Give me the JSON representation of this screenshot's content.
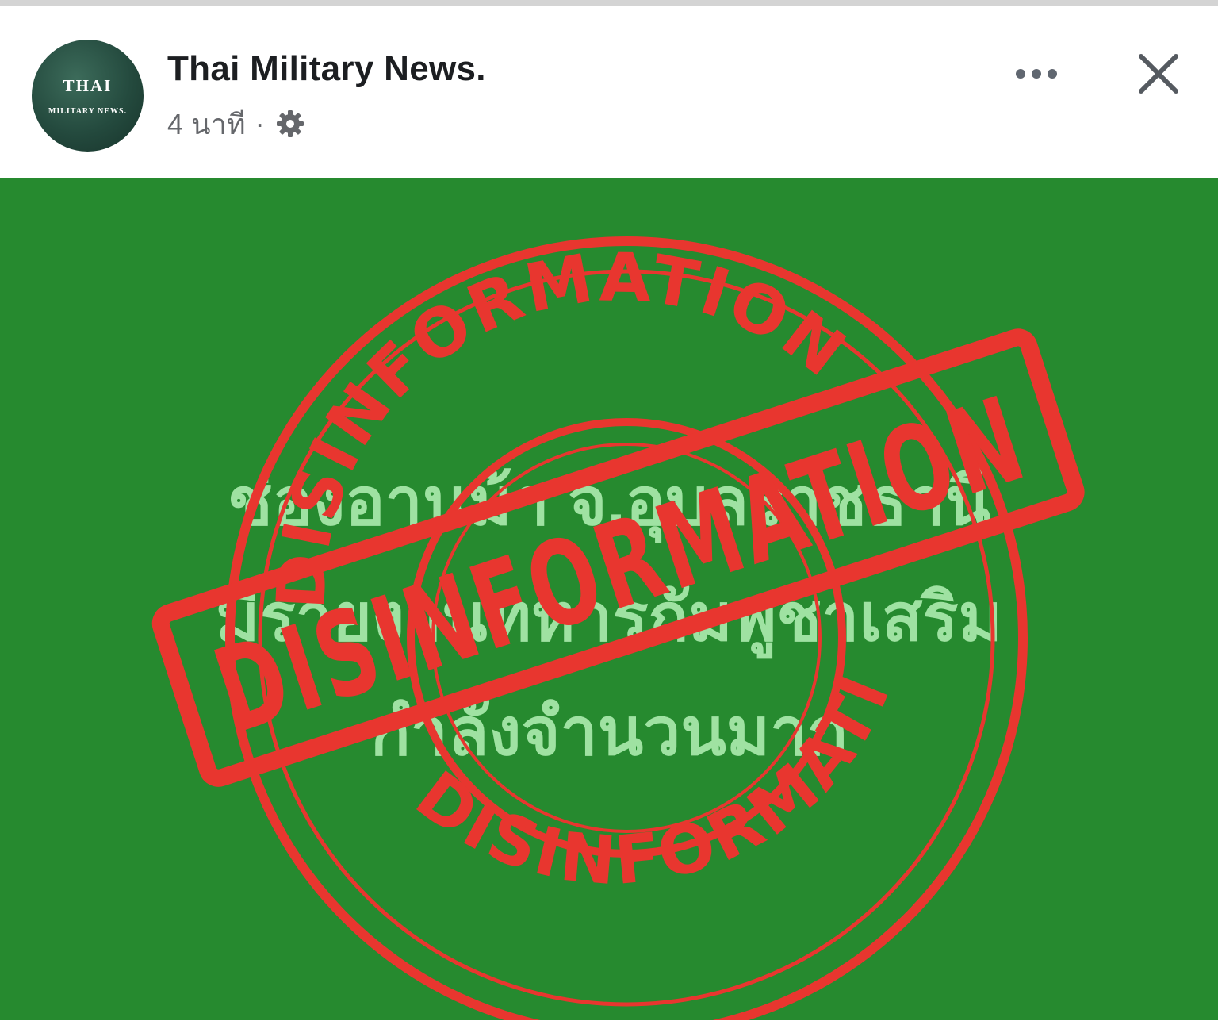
{
  "header": {
    "page_name": "Thai Military News.",
    "timestamp": "4 นาที",
    "separator": "·",
    "privacy_icon": "gear-icon",
    "more_icon": "more-horizontal-icon",
    "close_icon": "close-icon"
  },
  "avatar": {
    "logo_line_1": "THAI",
    "logo_line_2": "MILITARY NEWS."
  },
  "post_image": {
    "background_color": "#268a2f",
    "headline_lines": [
      "ช่องอานม้า จ.อุบลราชธานี",
      "มีรายงานทหารกัมพูชาเสริม",
      "กำลังจำนวนมาก"
    ],
    "stamp": {
      "ring_top_text": "DISINFORMATION",
      "ring_bottom_text": "DISINFORMATION",
      "banner_text": "DISINFORMATION",
      "color": "#e8362f"
    }
  }
}
